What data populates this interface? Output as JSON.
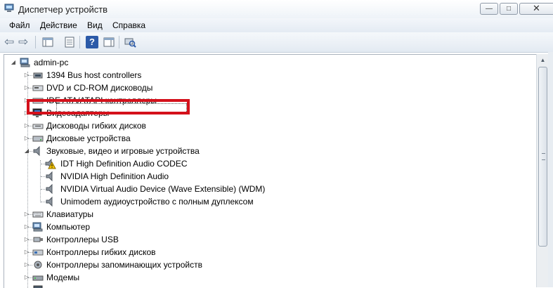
{
  "window": {
    "title": "Диспетчер устройств",
    "minimize_glyph": "—",
    "maximize_glyph": "□",
    "close_glyph": "✕"
  },
  "menu": [
    {
      "label": "Файл"
    },
    {
      "label": "Действие"
    },
    {
      "label": "Вид"
    },
    {
      "label": "Справка"
    }
  ],
  "toolbar": {
    "back_glyph": "⇦",
    "forward_glyph": "⇨",
    "help_glyph": "?"
  },
  "tree": {
    "root": "admin-pc",
    "categories": [
      {
        "label": "1394 Bus host controllers",
        "expanded": false,
        "icon": "firewire-icon"
      },
      {
        "label": "DVD и CD-ROM дисководы",
        "expanded": false,
        "icon": "optical-drive-icon"
      },
      {
        "label": "IDE ATA/ATAPI контроллеры",
        "expanded": false,
        "icon": "ide-controller-icon"
      },
      {
        "label": "Видеоадаптеры",
        "expanded": false,
        "icon": "display-adapter-icon"
      },
      {
        "label": "Дисководы гибких дисков",
        "expanded": false,
        "icon": "floppy-drive-icon"
      },
      {
        "label": "Дисковые устройства",
        "expanded": false,
        "icon": "disk-drive-icon"
      },
      {
        "label": "Звуковые, видео и игровые устройства",
        "expanded": true,
        "icon": "sound-device-icon"
      },
      {
        "label": "Клавиатуры",
        "expanded": false,
        "icon": "keyboard-icon"
      },
      {
        "label": "Компьютер",
        "expanded": false,
        "icon": "computer-icon"
      },
      {
        "label": "Контроллеры USB",
        "expanded": false,
        "icon": "usb-controller-icon"
      },
      {
        "label": "Контроллеры гибких дисков",
        "expanded": false,
        "icon": "floppy-controller-icon"
      },
      {
        "label": "Контроллеры запоминающих устройств",
        "expanded": false,
        "icon": "storage-controller-icon"
      },
      {
        "label": "Модемы",
        "expanded": false,
        "icon": "modem-icon"
      }
    ],
    "sound_children": [
      {
        "label": "IDT High Definition Audio CODEC",
        "warning": true
      },
      {
        "label": "NVIDIA High Definition Audio",
        "warning": false
      },
      {
        "label": "NVIDIA Virtual Audio Device (Wave Extensible) (WDM)",
        "warning": false
      },
      {
        "label": "Unimodem аудиоустройство с полным дуплексом",
        "warning": false
      }
    ],
    "selected_item": "IDT High Definition Audio CODEC"
  },
  "colors": {
    "highlight_border": "#d4111b",
    "warning_yellow": "#f4c400"
  }
}
